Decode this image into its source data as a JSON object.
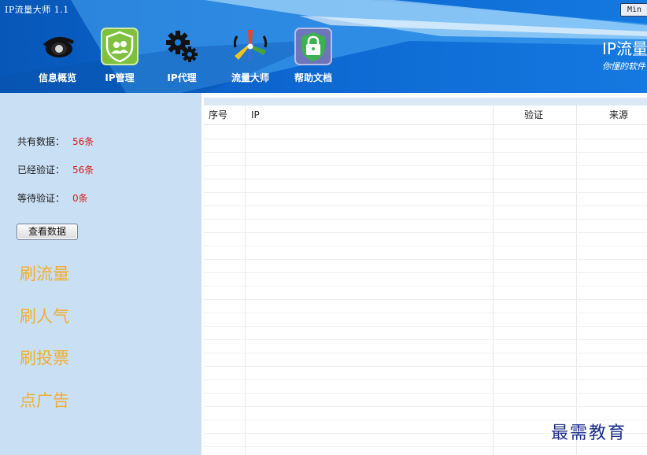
{
  "window": {
    "title": "IP流量大师 1.1",
    "min_label": "Min"
  },
  "nav": {
    "items": [
      {
        "label": "信息概览",
        "icon": "eye-icon"
      },
      {
        "label": "IP管理",
        "icon": "users-icon"
      },
      {
        "label": "IP代理",
        "icon": "gears-icon"
      },
      {
        "label": "流量大师",
        "icon": "pinwheel-icon"
      },
      {
        "label": "帮助文档",
        "icon": "lock-shield-icon"
      }
    ]
  },
  "brand": {
    "title": "IP流量",
    "slogan": "你懂的软件"
  },
  "sidebar": {
    "stats": [
      {
        "label": "共有数据：",
        "value": "56条"
      },
      {
        "label": "已经验证：",
        "value": "56条"
      },
      {
        "label": "等待验证：",
        "value": "0条"
      }
    ],
    "view_button": "查看数据",
    "actions": [
      "刷流量",
      "刷人气",
      "刷投票",
      "点广告"
    ]
  },
  "table": {
    "columns": [
      "序号",
      "IP",
      "验证",
      "来源"
    ]
  },
  "watermark": "最需教育",
  "colors": {
    "header_blue": "#0d67d1",
    "sidebar_bg": "#c9dff4",
    "stat_red": "#d62020",
    "action_orange": "#f2ad2d"
  }
}
